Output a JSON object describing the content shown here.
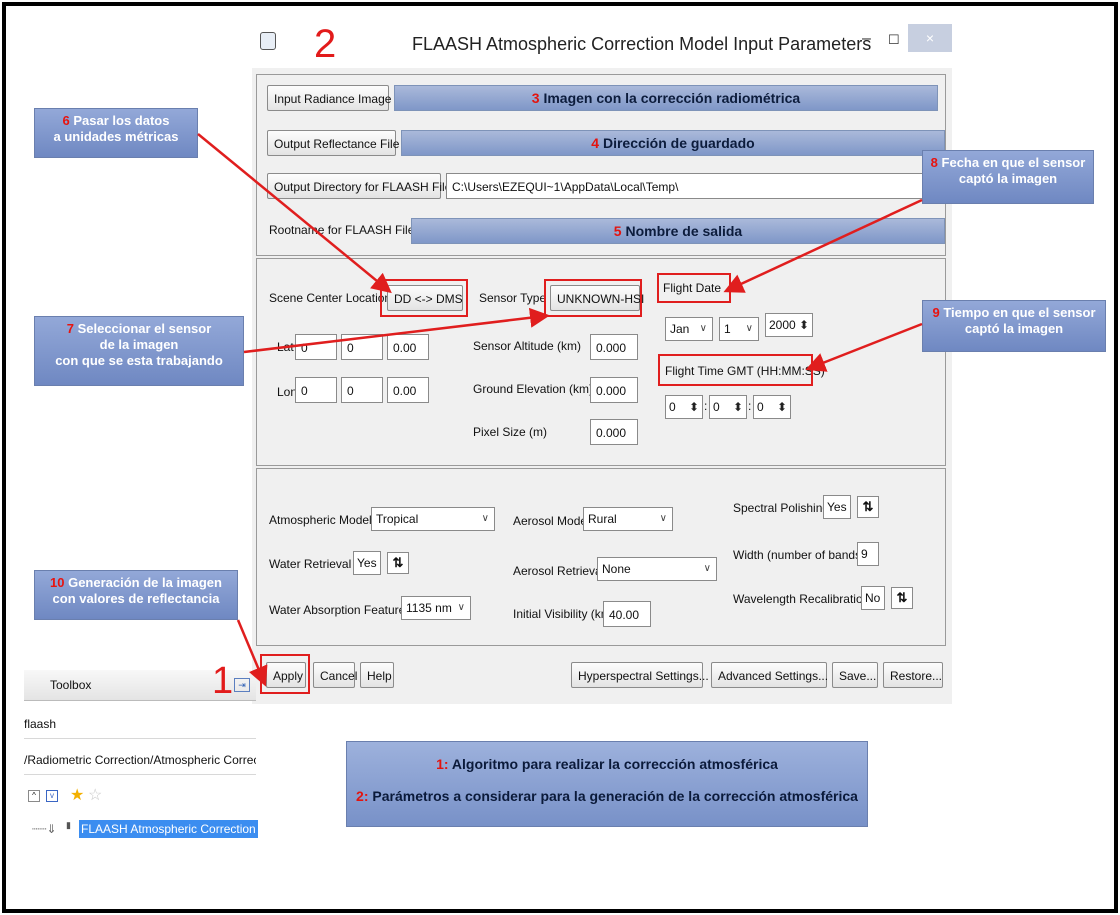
{
  "window": {
    "title": "FLAASH Atmospheric Correction Model Input Parameters",
    "number": "2",
    "minimize": "–",
    "maximize": "☐",
    "close": "×"
  },
  "files": {
    "input_radiance_label": "Input Radiance Image",
    "input_radiance_num": "3",
    "input_radiance_value": "Imagen con la corrección radiométrica",
    "output_reflectance_label": "Output Reflectance File",
    "output_reflectance_num": "4",
    "output_reflectance_value": "Dirección de guardado",
    "output_dir_label": "Output Directory for FLAASH Files",
    "output_dir_value": "C:\\Users\\EZEQUI~1\\AppData\\Local\\Temp\\",
    "rootname_label": "Rootname for FLAASH Files",
    "rootname_num": "5",
    "rootname_value": "Nombre de salida"
  },
  "scene": {
    "center_label": "Scene Center Location",
    "dd_dms_button": "DD <-> DMS",
    "lat_label": "Lat",
    "lon_label": "Lon",
    "lat": [
      "0",
      "0",
      "0.00"
    ],
    "lon": [
      "0",
      "0",
      "0.00"
    ],
    "sensor_type_label": "Sensor Type",
    "sensor_type_value": "UNKNOWN-HSI",
    "sensor_altitude_label": "Sensor Altitude (km)",
    "sensor_altitude_value": "0.000",
    "ground_elevation_label": "Ground Elevation (km)",
    "ground_elevation_value": "0.000",
    "pixel_size_label": "Pixel Size (m)",
    "pixel_size_value": "0.000",
    "flight_date_label": "Flight Date",
    "month": "Jan",
    "day": "1",
    "year": "2000",
    "flight_time_label": "Flight Time GMT (HH:MM:SS)",
    "hh": "0",
    "mm": "0",
    "ss": "0"
  },
  "model": {
    "atmospheric_model_label": "Atmospheric Model",
    "atmospheric_model_value": "Tropical",
    "water_retrieval_label": "Water Retrieval",
    "water_retrieval_value": "Yes",
    "water_absorption_label": "Water Absorption Feature",
    "water_absorption_value": "1135 nm",
    "aerosol_model_label": "Aerosol Model",
    "aerosol_model_value": "Rural",
    "aerosol_retrieval_label": "Aerosol Retrieval",
    "aerosol_retrieval_value": "None",
    "initial_visibility_label": "Initial Visibility (km)",
    "initial_visibility_value": "40.00",
    "spectral_polishing_label": "Spectral Polishing",
    "spectral_polishing_value": "Yes",
    "width_label": "Width (number of bands)",
    "width_value": "9",
    "wavelength_recal_label": "Wavelength Recalibration",
    "wavelength_recal_value": "No"
  },
  "actions": {
    "apply": "Apply",
    "cancel": "Cancel",
    "help": "Help",
    "hyperspectral": "Hyperspectral Settings...",
    "advanced": "Advanced Settings...",
    "save": "Save...",
    "restore": "Restore..."
  },
  "toolbox": {
    "title": "Toolbox",
    "number": "1",
    "search": "flaash",
    "path": "/Radiometric Correction/Atmospheric Correction",
    "tool": "FLAASH Atmospheric Correction"
  },
  "annotations": {
    "a6_num": "6",
    "a6_line1": "Pasar los datos",
    "a6_line2": "a unidades métricas",
    "a7_num": "7",
    "a7_line1": "Seleccionar el sensor",
    "a7_line2": "de la imagen",
    "a7_line3": "con que se esta trabajando",
    "a8_num": "8",
    "a8_line1": "Fecha en que el sensor",
    "a8_line2": "captó  la imagen",
    "a9_num": "9",
    "a9_line1": "Tiempo en que el sensor",
    "a9_line2": "captó la imagen",
    "a10_num": "10",
    "a10_line1": "Generación de la imagen",
    "a10_line2": "con valores de reflectancia"
  },
  "legend": {
    "n1": "1:",
    "t1": "Algoritmo para realizar la corrección atmosférica",
    "n2": "2:",
    "t2": "Parámetros a considerar para la generación de la corrección atmosférica"
  },
  "colors": {
    "annotation_red": "#e3140f",
    "callout_blue": "#7f97c8"
  }
}
